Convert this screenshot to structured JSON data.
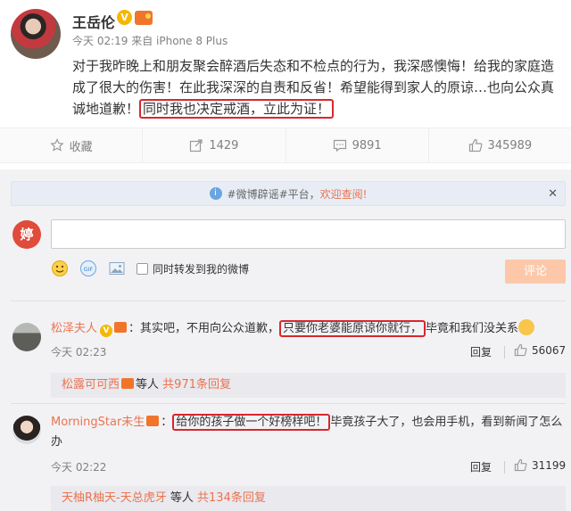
{
  "post": {
    "username": "王岳伦",
    "meta": "今天 02:19 来自 iPhone 8 Plus",
    "content_before": "对于我昨晚上和朋友聚会醉酒后失态和不检点的行为，我深感懊悔！给我的家庭造成了很大的伤害！在此我深深的自责和反省！希望能得到家人的原谅…也向公众真诚地道歉！",
    "content_highlight": "同时我也决定戒酒，立此为证！"
  },
  "actions": [
    {
      "label": "收藏",
      "icon": "star-icon"
    },
    {
      "label": "1429",
      "icon": "share-icon"
    },
    {
      "label": "9891",
      "icon": "comment-icon"
    },
    {
      "label": "345989",
      "icon": "like-icon"
    }
  ],
  "notice": {
    "text_before": "#微博辟谣#平台，",
    "link": "欢迎查阅!"
  },
  "composer": {
    "forward_label": "同时转发到我的微博",
    "submit_label": "评论"
  },
  "comments": [
    {
      "username": "松泽夫人",
      "text_before": "：其实吧，不用向公众道歉，",
      "text_highlight": "只要你老婆能原谅你就行，",
      "text_after": "毕竟和我们没关系",
      "time": "今天 02:23",
      "reply_label": "回复",
      "likes": "56067",
      "sub_replier": "松露可可西",
      "sub_mid": "等人",
      "sub_count": "共971条回复"
    },
    {
      "username": "MorningStar未生",
      "text_before": "：",
      "text_highlight": "给你的孩子做一个好榜样吧！",
      "text_after": "毕竟孩子大了，也会用手机，看到新闻了怎么办",
      "time": "今天 02:22",
      "reply_label": "回复",
      "likes": "31199",
      "sub_replier": "天柚R柚天-天总虎牙",
      "sub_mid": "等人",
      "sub_count": "共134条回复"
    }
  ],
  "colors": {
    "accent": "#eb7350",
    "highlight_border": "#d8272d",
    "verified": "#f5b700"
  }
}
